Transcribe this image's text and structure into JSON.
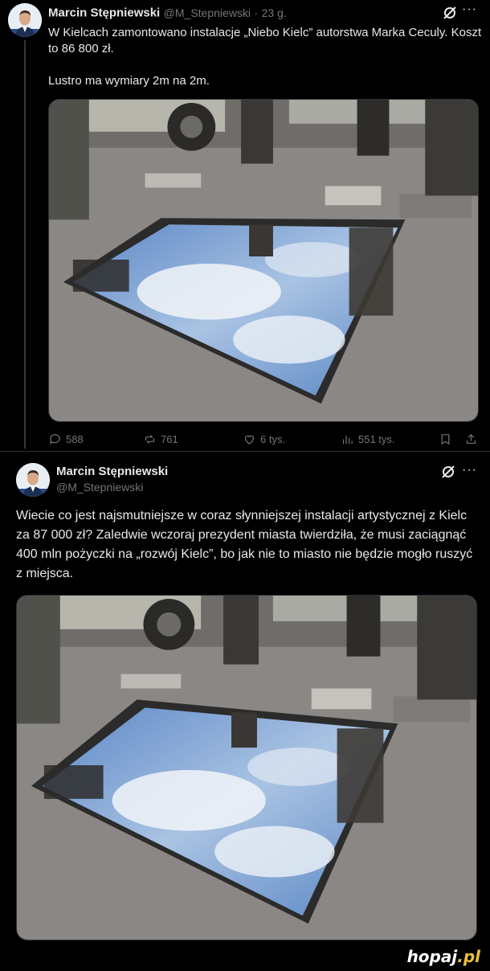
{
  "tweet1": {
    "author_name": "Marcin Stępniewski",
    "handle": "@M_Stepniewski",
    "separator": "·",
    "time": "23 g.",
    "text": "W Kielcach zamontowano instalacje „Niebo Kielc” autorstwa Marka Ceculy. Koszt to 86 800 zł.\n\nLustro ma wymiary 2m na 2m.",
    "more_label": "···",
    "actions": {
      "replies": "588",
      "reposts": "761",
      "likes": "6 tys.",
      "views": "551 tys."
    }
  },
  "tweet2": {
    "author_name": "Marcin Stępniewski",
    "handle": "@M_Stepniewski",
    "text": "Wiecie co jest najsmutniejsze w coraz słynniejszej instalacji artystycznej z Kielc za 87 000 zł? Zaledwie wczoraj prezydent miasta twierdziła, że musi zaciągnąć 400 mln pożyczki na „rozwój Kielc”, bo jak nie to miasto nie będzie mogło ruszyć z miejsca."
  },
  "watermark": {
    "brand": "hopaj",
    "tld": ".pl"
  },
  "icons": {
    "reply": "reply-icon",
    "repost": "repost-icon",
    "like": "heart-icon",
    "views": "bar-chart-icon",
    "bookmark": "bookmark-icon",
    "share": "share-icon",
    "grok": "grok-icon",
    "more": "more-icon"
  },
  "colors": {
    "background": "#000000",
    "text": "#e7e9ea",
    "muted": "#71767b",
    "border": "#2f3336"
  }
}
